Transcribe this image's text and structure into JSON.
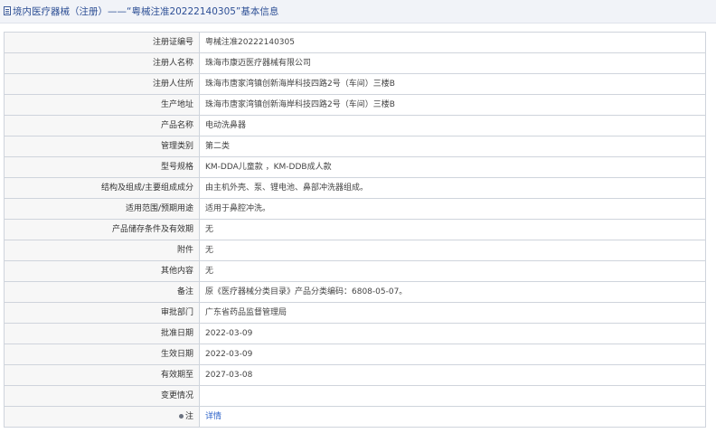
{
  "header": {
    "title": "境内医疗器械（注册）——“粤械注准20222140305”基本信息"
  },
  "rows": [
    {
      "label": "注册证编号",
      "value": "粤械注准20222140305"
    },
    {
      "label": "注册人名称",
      "value": "珠海市康迈医疗器械有限公司"
    },
    {
      "label": "注册人住所",
      "value": "珠海市唐家湾镇创新海岸科技四路2号（车间）三楼B"
    },
    {
      "label": "生产地址",
      "value": "珠海市唐家湾镇创新海岸科技四路2号（车间）三楼B"
    },
    {
      "label": "产品名称",
      "value": "电动洗鼻器"
    },
    {
      "label": "管理类别",
      "value": "第二类"
    },
    {
      "label": "型号规格",
      "value": "KM-DDA儿童款 ，KM-DDB成人款"
    },
    {
      "label": "结构及组成/主要组成成分",
      "value": "由主机外壳、泵、锂电池、鼻部冲洗器组成。"
    },
    {
      "label": "适用范围/预期用途",
      "value": "适用于鼻腔冲洗。"
    },
    {
      "label": "产品储存条件及有效期",
      "value": "无"
    },
    {
      "label": "附件",
      "value": "无"
    },
    {
      "label": "其他内容",
      "value": "无"
    },
    {
      "label": "备注",
      "value": "原《医疗器械分类目录》产品分类编码：6808-05-07。"
    },
    {
      "label": "审批部门",
      "value": "广东省药品监督管理局"
    },
    {
      "label": "批准日期",
      "value": "2022-03-09"
    },
    {
      "label": "生效日期",
      "value": "2022-03-09"
    },
    {
      "label": "有效期至",
      "value": "2027-03-08"
    },
    {
      "label": "变更情况",
      "value": ""
    }
  ],
  "note_row": {
    "icon": "pin-icon",
    "label": "注",
    "link": "详情"
  },
  "colors": {
    "title": "#2d4f95",
    "link": "#2a60c8",
    "label_bg": "#f7f7f7",
    "border": "#cfd4dc"
  }
}
